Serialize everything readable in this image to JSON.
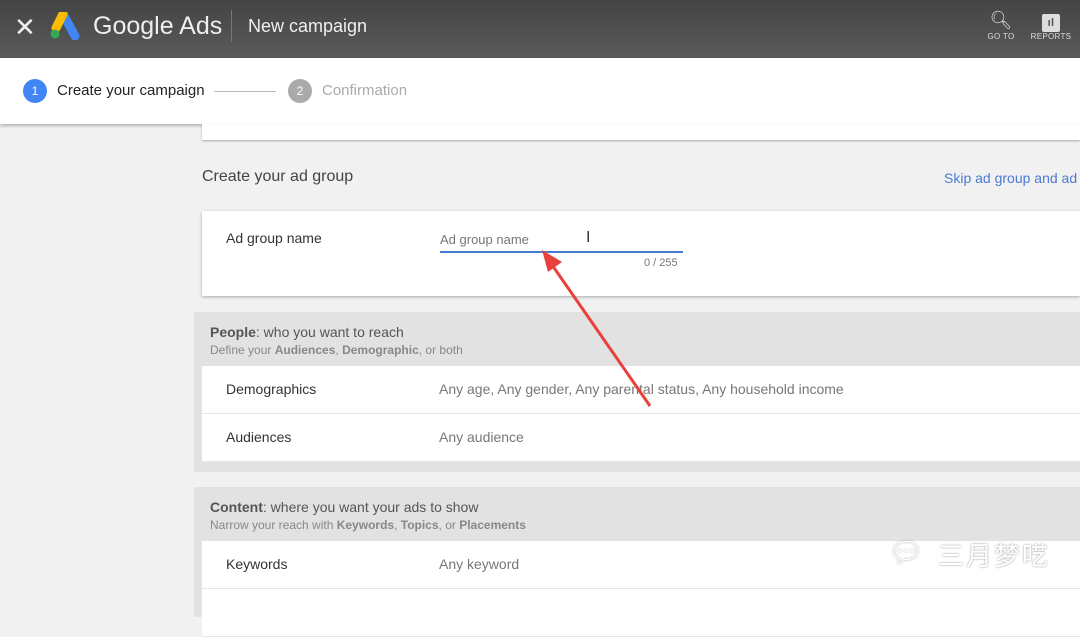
{
  "header": {
    "title": "New campaign",
    "brand": "Google Ads",
    "tools": [
      {
        "label": "GO TO",
        "icon": "search-icon"
      },
      {
        "label": "REPORTS",
        "icon": "reports-icon"
      }
    ]
  },
  "stepper": [
    {
      "num": "1",
      "label": "Create your campaign",
      "active": true
    },
    {
      "num": "2",
      "label": "Confirmation",
      "active": false
    }
  ],
  "ad_group": {
    "section_title": "Create your ad group",
    "skip_link": "Skip ad group and ad",
    "name_label": "Ad group name",
    "placeholder": "Ad group name",
    "counter": "0 / 255"
  },
  "people": {
    "title": "People",
    "title_rest": ": who you want to reach",
    "sub_prefix": "Define your ",
    "sub_b1": "Audiences",
    "sub_sep": ", ",
    "sub_b2": "Demographic",
    "sub_suffix": ", or both",
    "rows": [
      {
        "label": "Demographics",
        "value": "Any age, Any gender, Any parental status, Any household income"
      },
      {
        "label": "Audiences",
        "value": "Any audience"
      }
    ]
  },
  "content": {
    "title": "Content",
    "title_rest": ": where you want your ads to show",
    "sub_prefix": "Narrow your reach with ",
    "sub_b1": "Keywords",
    "sub_sep": ", ",
    "sub_b2": "Topics",
    "sub_mid": ", or ",
    "sub_b3": "Placements",
    "rows": [
      {
        "label": "Keywords",
        "value": "Any keyword"
      }
    ]
  },
  "watermark": "三月梦呓",
  "colors": {
    "accent": "#4a7ad0",
    "annotation_arrow": "#e8413c"
  }
}
